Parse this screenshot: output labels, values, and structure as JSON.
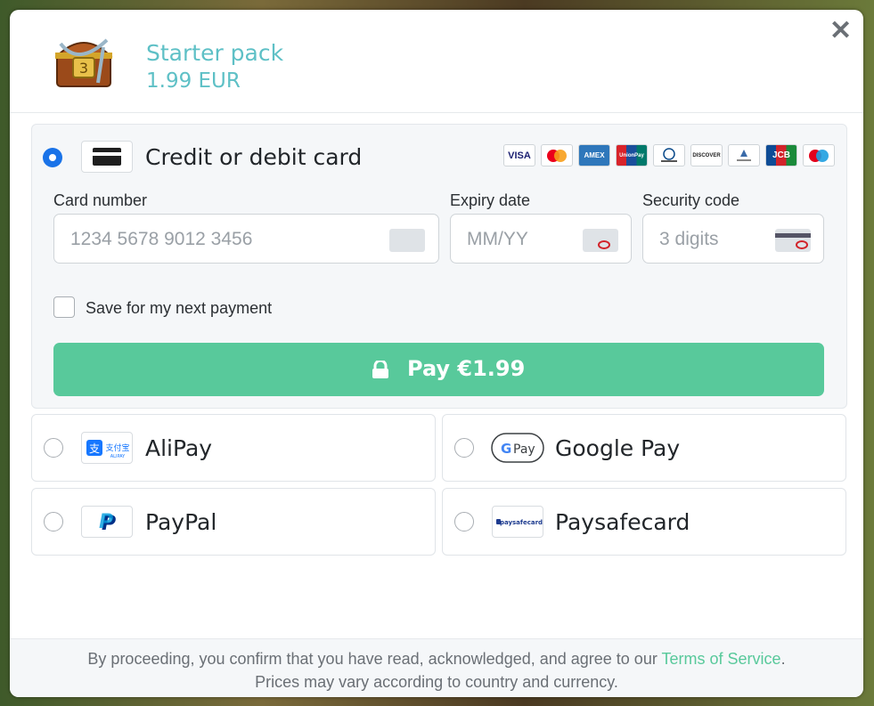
{
  "product": {
    "title": "Starter pack",
    "price": "1.99 EUR"
  },
  "close_icon": "close-icon",
  "card": {
    "label": "Credit or debit card",
    "logos": [
      "VISA",
      "Mastercard",
      "AMEX",
      "UnionPay",
      "Diners Club",
      "DISCOVER",
      "iProcard",
      "JCB",
      "Maestro"
    ],
    "card_number_label": "Card number",
    "card_number_placeholder": "1234 5678 9012 3456",
    "expiry_label": "Expiry date",
    "expiry_placeholder": "MM/YY",
    "security_label": "Security code",
    "security_placeholder": "3 digits",
    "save_label": "Save for my next payment",
    "pay_label": "Pay €1.99"
  },
  "methods": {
    "alipay": "AliPay",
    "googlepay": "Google Pay",
    "paypal": "PayPal",
    "paysafecard": "Paysafecard"
  },
  "footer": {
    "line1_prefix": "By proceeding, you confirm that you have read, acknowledged, and agree to our ",
    "tos_link": "Terms of Service",
    "line1_suffix": ".",
    "line2": "Prices may vary according to country and currency."
  },
  "colors": {
    "accent": "#58c99b",
    "title": "#5ec0c6",
    "radio_selected": "#1a73e8"
  }
}
